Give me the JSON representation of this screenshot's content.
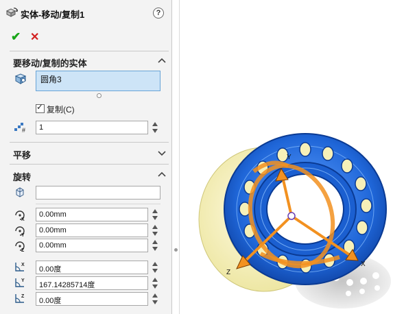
{
  "panel": {
    "title": "实体-移动/复制1",
    "help_label": "?",
    "ok_label": "✔",
    "cancel_label": "✕",
    "bodies_section": {
      "title": "要移动/复制的实体",
      "selected_body": "圆角3",
      "copy_checkbox_label": "复制(C)",
      "copy_checked": true,
      "copy_count": "1"
    },
    "translate_section": {
      "title": "平移",
      "expanded": false
    },
    "rotate_section": {
      "title": "旋转",
      "expanded": true,
      "reference": "",
      "x_origin": "0.00mm",
      "y_origin": "0.00mm",
      "z_origin": "0.00mm",
      "x_angle": "0.00度",
      "y_angle": "167.14285714度",
      "z_angle": "0.00度"
    }
  },
  "viewport": {
    "triad_labels": [
      "X",
      "Y",
      "Z"
    ],
    "colors": {
      "body_blue": "#1f66d8",
      "triad_orange": "#f29120",
      "ghost_yellow": "#f4efb6"
    }
  }
}
